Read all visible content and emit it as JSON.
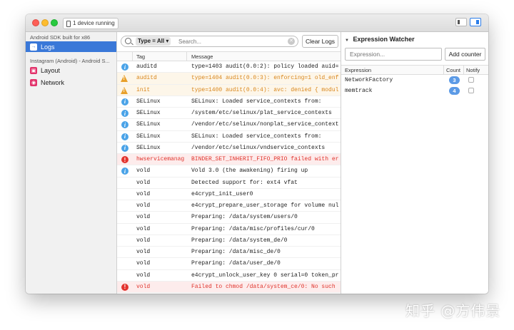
{
  "titlebar": {
    "device_label": "1 device running"
  },
  "sidebar": {
    "device_header": "Android SDK built for x86",
    "logs_label": "Logs",
    "app_header": "Instagram (Android) - Android S...",
    "layout_label": "Layout",
    "network_label": "Network"
  },
  "logs": {
    "type_filter": "Type = All ▾",
    "search_placeholder": "Search...",
    "clear_label": "Clear Logs",
    "col_tag": "Tag",
    "col_message": "Message",
    "rows": [
      {
        "level": "info",
        "tag": "auditd",
        "message": "type=1403 audit(0.0:2): policy loaded auid="
      },
      {
        "level": "warn",
        "tag": "auditd",
        "message": "type=1404 audit(0.0:3): enforcing=1 old_enf"
      },
      {
        "level": "warn",
        "tag": "init",
        "message": "type=1400 audit(0.0:4): avc: denied { modul"
      },
      {
        "level": "info",
        "tag": "SELinux",
        "message": "SELinux: Loaded service_contexts from:"
      },
      {
        "level": "info",
        "tag": "SELinux",
        "message": "/system/etc/selinux/plat_service_contexts"
      },
      {
        "level": "info",
        "tag": "SELinux",
        "message": "/vendor/etc/selinux/nonplat_service_context"
      },
      {
        "level": "info",
        "tag": "SELinux",
        "message": "SELinux: Loaded service_contexts from:"
      },
      {
        "level": "info",
        "tag": "SELinux",
        "message": "/vendor/etc/selinux/vndservice_contexts"
      },
      {
        "level": "error",
        "tag": "hwservicemanag",
        "message": "BINDER_SET_INHERIT_FIFO_PRIO failed with er"
      },
      {
        "level": "info",
        "tag": "vold",
        "message": "Vold 3.0 (the awakening) firing up"
      },
      {
        "level": "none",
        "tag": "vold",
        "message": "Detected support for: ext4 vfat"
      },
      {
        "level": "none",
        "tag": "vold",
        "message": "e4crypt_init_user0"
      },
      {
        "level": "none",
        "tag": "vold",
        "message": "e4crypt_prepare_user_storage for volume nul"
      },
      {
        "level": "none",
        "tag": "vold",
        "message": "Preparing: /data/system/users/0"
      },
      {
        "level": "none",
        "tag": "vold",
        "message": "Preparing: /data/misc/profiles/cur/0"
      },
      {
        "level": "none",
        "tag": "vold",
        "message": "Preparing: /data/system_de/0"
      },
      {
        "level": "none",
        "tag": "vold",
        "message": "Preparing: /data/misc_de/0"
      },
      {
        "level": "none",
        "tag": "vold",
        "message": "Preparing: /data/user_de/0"
      },
      {
        "level": "none",
        "tag": "vold",
        "message": "e4crypt_unlock_user_key 0 serial=0 token_pr"
      },
      {
        "level": "error",
        "tag": "vold",
        "message": "Failed to chmod /data/system_ce/0: No such"
      }
    ]
  },
  "watcher": {
    "title": "Expression Watcher",
    "input_placeholder": "Expression...",
    "add_label": "Add counter",
    "col_expression": "Expression",
    "col_count": "Count",
    "col_notify": "Notify",
    "rows": [
      {
        "expression": "NetworkFactory",
        "count": "3"
      },
      {
        "expression": "memtrack",
        "count": "4"
      }
    ]
  },
  "watermark": "知乎 @方伟景"
}
